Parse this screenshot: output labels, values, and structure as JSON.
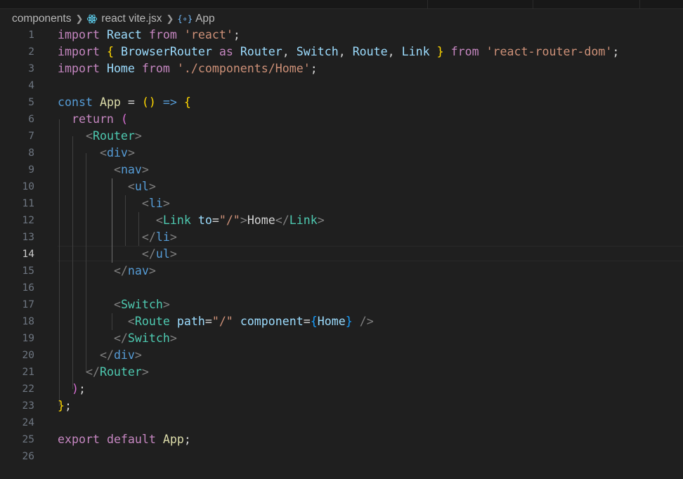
{
  "breadcrumb": {
    "folder": "components",
    "file": "react vite.jsx",
    "symbol_icon": "{∘}",
    "symbol": "App",
    "separator_icon": "chevron-right-icon"
  },
  "editor": {
    "active_line": 14,
    "line_numbers": [
      "1",
      "2",
      "3",
      "4",
      "5",
      "6",
      "7",
      "8",
      "9",
      "10",
      "11",
      "12",
      "13",
      "14",
      "15",
      "16",
      "17",
      "18",
      "19",
      "20",
      "21",
      "22",
      "23",
      "24",
      "25",
      "26"
    ],
    "code": {
      "l1": [
        "import",
        " ",
        "React",
        " ",
        "from",
        " ",
        "'react'",
        ";"
      ],
      "l2": [
        "import",
        " ",
        "{",
        " ",
        "BrowserRouter",
        " ",
        "as",
        " ",
        "Router",
        ", ",
        "Switch",
        ", ",
        "Route",
        ", ",
        "Link",
        " ",
        "}",
        " ",
        "from",
        " ",
        "'react-router-dom'",
        ";"
      ],
      "l3": [
        "import",
        " ",
        "Home",
        " ",
        "from",
        " ",
        "'./components/Home'",
        ";"
      ],
      "l4": [],
      "l5": [
        "const",
        " ",
        "App",
        " = ",
        "()",
        " ",
        "=>",
        " ",
        "{"
      ],
      "l6": [
        "  ",
        "return",
        " ",
        "("
      ],
      "l7": [
        "    ",
        "<",
        "Router",
        ">"
      ],
      "l8": [
        "      ",
        "<",
        "div",
        ">"
      ],
      "l9": [
        "        ",
        "<",
        "nav",
        ">"
      ],
      "l10": [
        "          ",
        "<",
        "ul",
        ">"
      ],
      "l11": [
        "            ",
        "<",
        "li",
        ">"
      ],
      "l12": [
        "              ",
        "<",
        "Link",
        " ",
        "to",
        "=",
        "\"/\"",
        ">",
        "Home",
        "</",
        "Link",
        ">"
      ],
      "l13": [
        "            ",
        "</",
        "li",
        ">"
      ],
      "l14": [
        "            ",
        "</",
        "ul",
        ">"
      ],
      "l15": [
        "        ",
        "</",
        "nav",
        ">"
      ],
      "l16": [],
      "l17": [
        "        ",
        "<",
        "Switch",
        ">"
      ],
      "l18": [
        "          ",
        "<",
        "Route",
        " ",
        "path",
        "=",
        "\"/\"",
        " ",
        "component",
        "=",
        "{",
        "Home",
        "}",
        " ",
        "/>"
      ],
      "l19": [
        "        ",
        "</",
        "Switch",
        ">"
      ],
      "l20": [
        "      ",
        "</",
        "div",
        ">"
      ],
      "l21": [
        "    ",
        "</",
        "Router",
        ">"
      ],
      "l22": [
        "  ",
        ")",
        ";"
      ],
      "l23": [
        "}",
        ";"
      ],
      "l24": [],
      "l25": [
        "export",
        " ",
        "default",
        " ",
        "App",
        ";"
      ],
      "l26": []
    }
  },
  "syntax_colors": {
    "background": "#1f1f1f",
    "keyword": "#c586c0",
    "storage": "#569cd6",
    "variable": "#9cdcfe",
    "function": "#dcdcaa",
    "string": "#ce9178",
    "component": "#4ec9b0",
    "bracket_gold": "#ffd700",
    "bracket_orchid": "#da70d6",
    "bracket_blue": "#179fff"
  }
}
